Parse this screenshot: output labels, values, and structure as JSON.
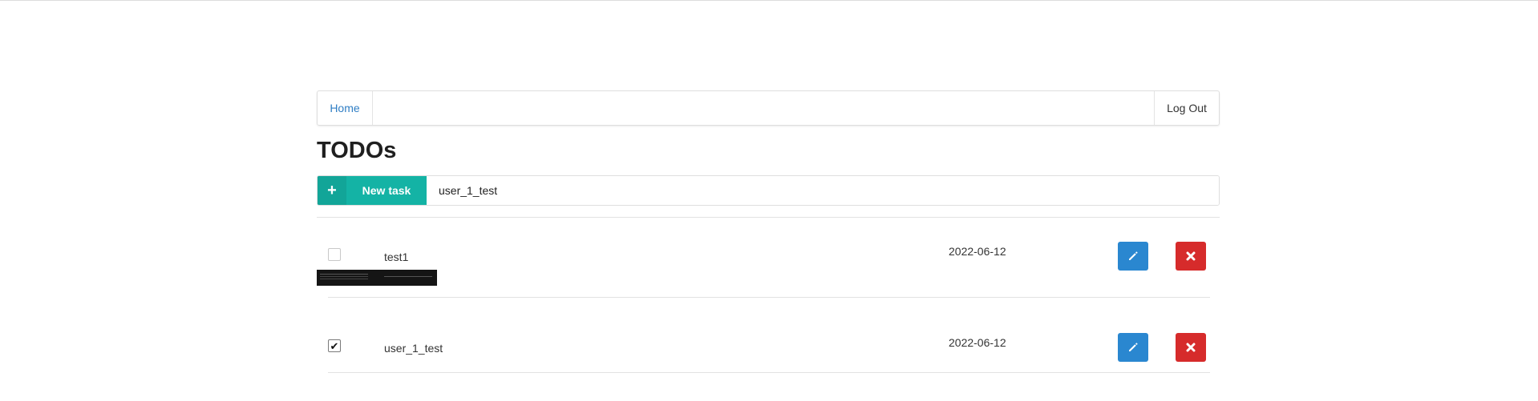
{
  "nav": {
    "home_label": "Home",
    "logout_label": "Log Out"
  },
  "page": {
    "title": "TODOs"
  },
  "new_task": {
    "button_label": "New task",
    "plus_glyph": "+",
    "input_value": "user_1_test"
  },
  "todos": [
    {
      "title": "test1",
      "date": "2022-06-12",
      "completed": false,
      "has_thumbnail": true
    },
    {
      "title": "user_1_test",
      "date": "2022-06-12",
      "completed": true,
      "has_thumbnail": false
    }
  ],
  "colors": {
    "accent_teal": "#14b3a5",
    "edit_blue": "#2a87d0",
    "delete_red": "#d62b2b",
    "link_blue": "#2f7ec4"
  },
  "icons": {
    "edit": "pencil-icon",
    "delete": "close-icon",
    "checkmark": "checkmark-icon",
    "add": "plus-icon"
  }
}
